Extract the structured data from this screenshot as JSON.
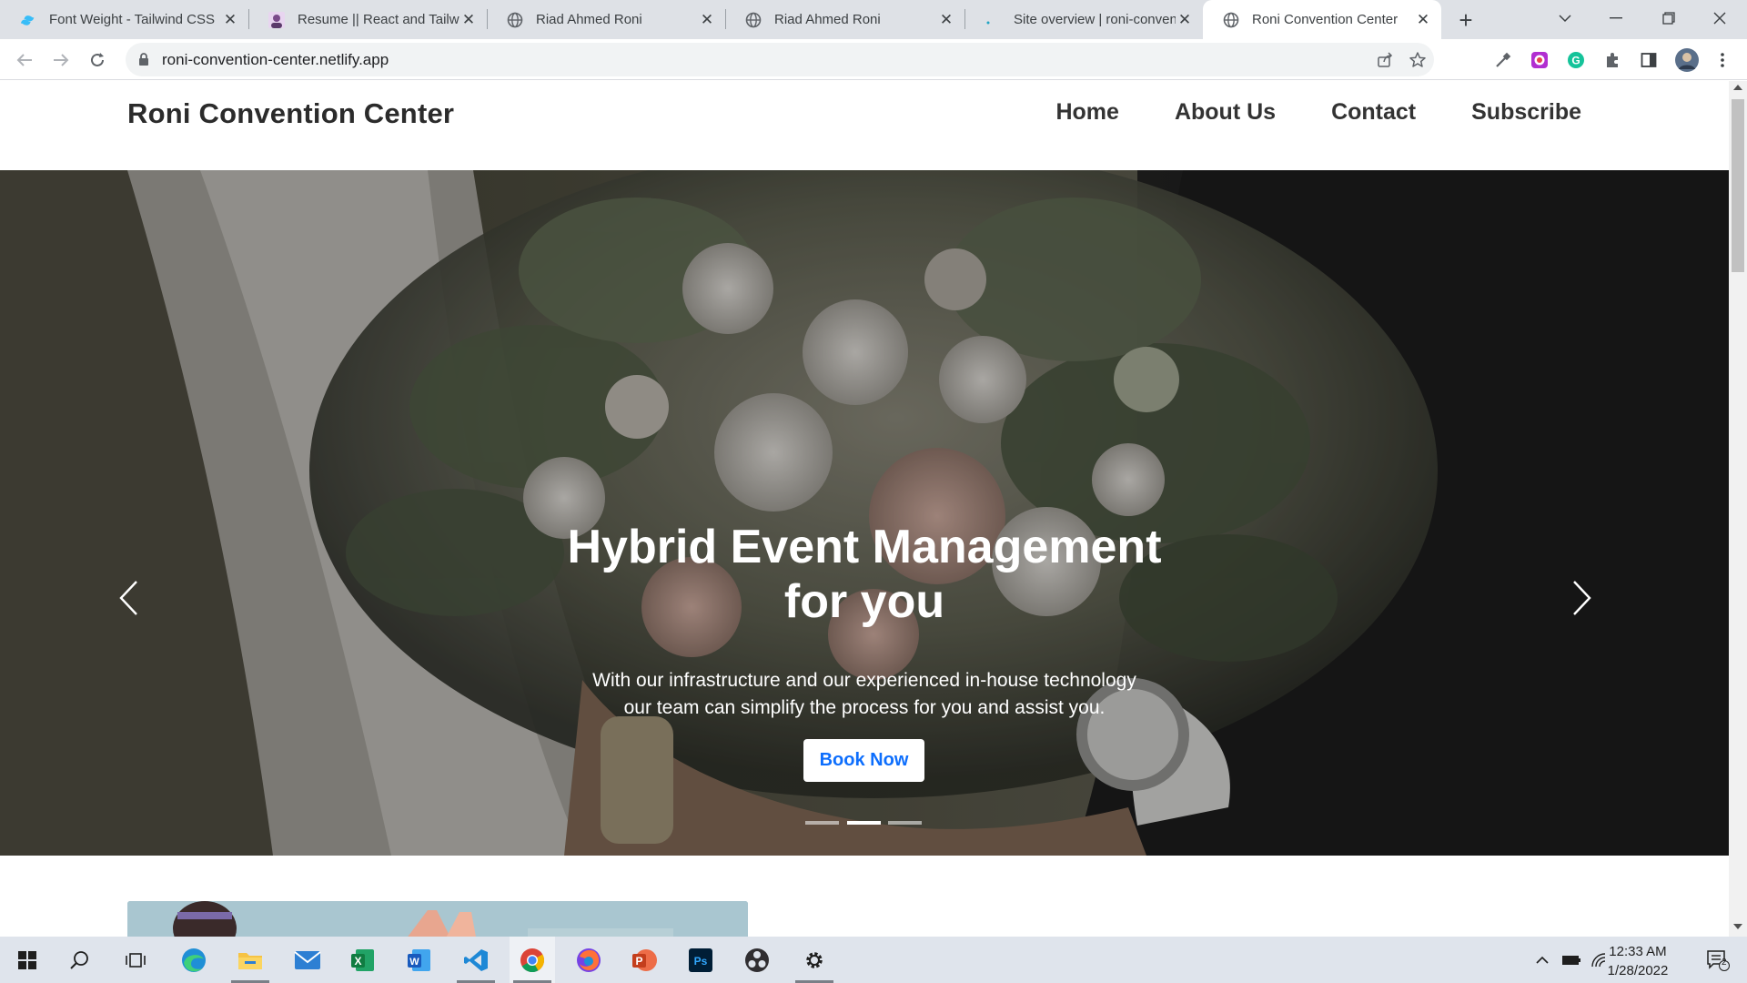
{
  "browser": {
    "tabs": [
      {
        "title": "Font Weight - Tailwind CSS",
        "icon": "tailwind-icon",
        "active": false
      },
      {
        "title": "Resume || React and Tailwind",
        "icon": "avatar-icon",
        "active": false
      },
      {
        "title": "Riad Ahmed Roni",
        "icon": "globe-icon",
        "active": false
      },
      {
        "title": "Riad Ahmed Roni",
        "icon": "globe-icon",
        "active": false
      },
      {
        "title": "Site overview | roni-convention",
        "icon": "netlify-icon",
        "active": false
      },
      {
        "title": "Roni Convention Center",
        "icon": "globe-icon",
        "active": true
      }
    ],
    "url": "roni-convention-center.netlify.app"
  },
  "site": {
    "logo": "Roni Convention Center",
    "nav": [
      "Home",
      "About Us",
      "Contact",
      "Subscribe"
    ]
  },
  "hero": {
    "title_line1": "Hybrid Event Management",
    "title_line2": "for you",
    "text_line1": "With our infrastructure and our experienced in-house technology",
    "text_line2": "our team can simplify the process for you and assist you.",
    "button": "Book Now",
    "slides": 3,
    "active_slide": 2
  },
  "taskbar": {
    "apps": [
      "windows-start-icon",
      "search-icon",
      "task-view-icon",
      "edge-icon",
      "file-explorer-icon",
      "mail-icon",
      "excel-icon",
      "word-icon",
      "vscode-icon",
      "chrome-icon",
      "firefox-icon",
      "powerpoint-icon",
      "photoshop-icon",
      "obs-icon",
      "settings-icon"
    ],
    "time": "12:33 AM",
    "date": "1/28/2022",
    "notifications": "2"
  }
}
